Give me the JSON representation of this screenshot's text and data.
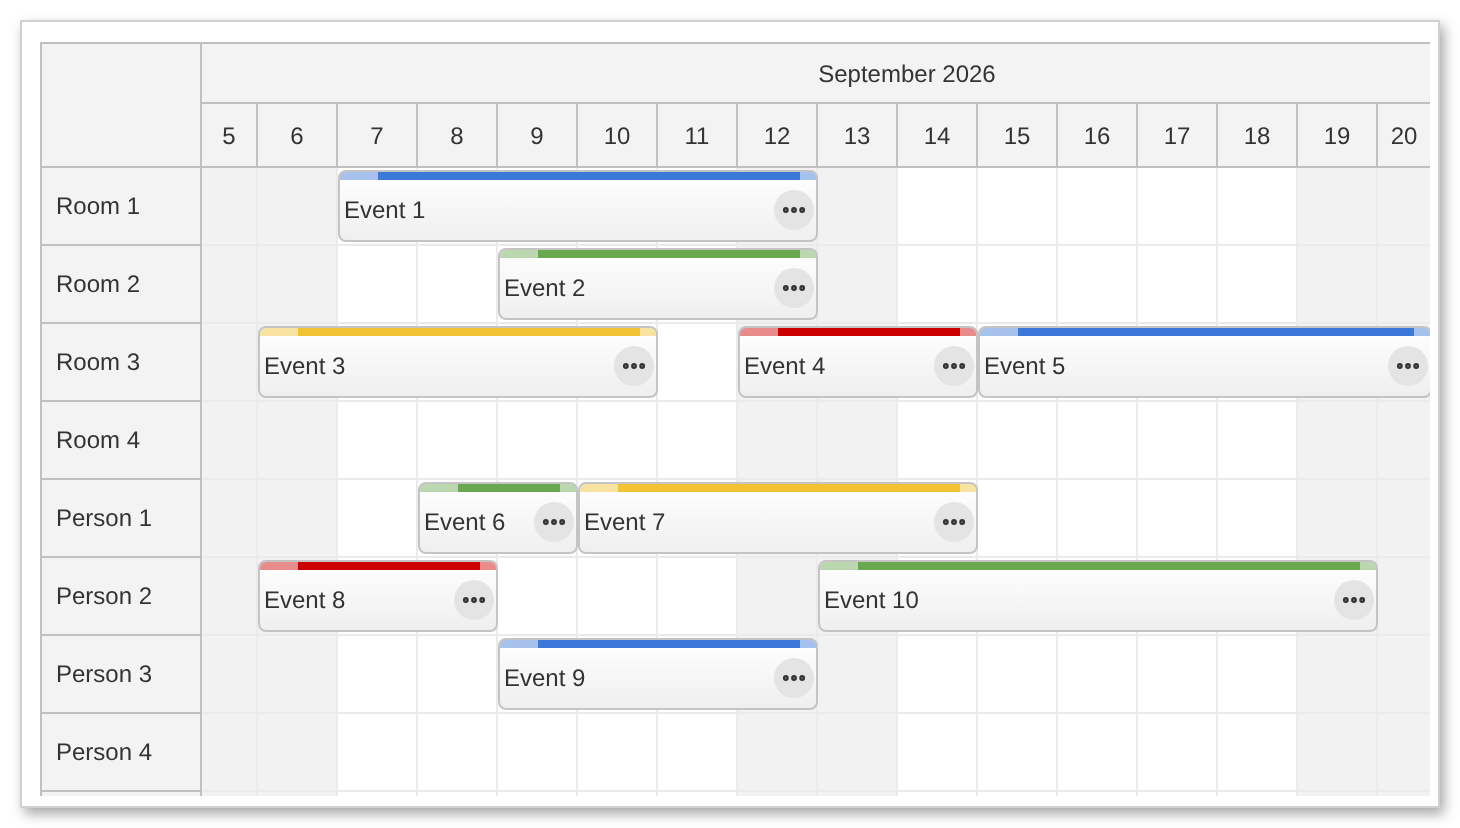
{
  "month": "September 2026",
  "days": [
    {
      "label": "5",
      "weekend": true
    },
    {
      "label": "6",
      "weekend": true
    },
    {
      "label": "7",
      "weekend": false
    },
    {
      "label": "8",
      "weekend": false
    },
    {
      "label": "9",
      "weekend": false
    },
    {
      "label": "10",
      "weekend": false
    },
    {
      "label": "11",
      "weekend": false
    },
    {
      "label": "12",
      "weekend": true
    },
    {
      "label": "13",
      "weekend": true
    },
    {
      "label": "14",
      "weekend": false
    },
    {
      "label": "15",
      "weekend": false
    },
    {
      "label": "16",
      "weekend": false
    },
    {
      "label": "17",
      "weekend": false
    },
    {
      "label": "18",
      "weekend": false
    },
    {
      "label": "19",
      "weekend": true
    },
    {
      "label": "20",
      "weekend": true
    }
  ],
  "resources": [
    {
      "name": "Room 1",
      "events": [
        {
          "text": "Event 1",
          "color": "#3c78d8"
        }
      ]
    },
    {
      "name": "Room 2",
      "events": [
        {
          "text": "Event 2",
          "color": "#6aa84f"
        }
      ]
    },
    {
      "name": "Room 3",
      "events": [
        {
          "text": "Event 3",
          "color": "#f1c232"
        },
        {
          "text": "Event 4",
          "color": "#cc0000"
        },
        {
          "text": "Event 5",
          "color": "#3c78d8"
        }
      ]
    },
    {
      "name": "Room 4"
    },
    {
      "name": "Person 1",
      "events": [
        {
          "text": "Event 6",
          "color": "#6aa84f"
        },
        {
          "text": "Event 7",
          "color": "#f1c232"
        }
      ]
    },
    {
      "name": "Person 2",
      "events": [
        {
          "text": "Event 8",
          "color": "#cc0000"
        },
        {
          "text": "Event 10",
          "color": "#6aa84f"
        }
      ]
    },
    {
      "name": "Person 3",
      "events": [
        {
          "text": "Event 9",
          "color": "#3c78d8"
        }
      ]
    },
    {
      "name": "Person 4"
    }
  ]
}
